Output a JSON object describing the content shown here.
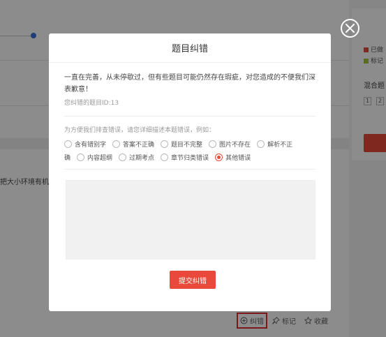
{
  "background": {
    "question_snippet": "把大小环境有机",
    "legend": [
      {
        "label": "已做",
        "color": "#e8493a"
      },
      {
        "label": "标记",
        "color": "#a6c43a"
      }
    ],
    "mixed_label": "混合题",
    "page_numbers": [
      "1",
      "2"
    ],
    "actions": {
      "correct_label": "纠错",
      "mark_label": "标记",
      "favorite_label": "收藏"
    }
  },
  "modal": {
    "title": "题目纠错",
    "intro": "一直在完善，从未停歇过，但有些题目可能仍然存在瑕疵，对您造成的不便我们深表歉意！",
    "question_id_text": "您纠错的题目ID:13",
    "hint": "为方便我们排查错误，请您详细描述本题错误，例如：",
    "options_row1": [
      "含有错别字",
      "答案不正确",
      "题目不完整",
      "图片不存在",
      "解析不正"
    ],
    "options_row2": [
      "确",
      "内容超纲",
      "过期考点",
      "章节归类错误",
      "其他错误"
    ],
    "selected_option": "其他错误",
    "textarea_placeholder": "",
    "submit_label": "提交纠错"
  },
  "colors": {
    "accent": "#e8493a",
    "highlight": "#e02c2c"
  }
}
